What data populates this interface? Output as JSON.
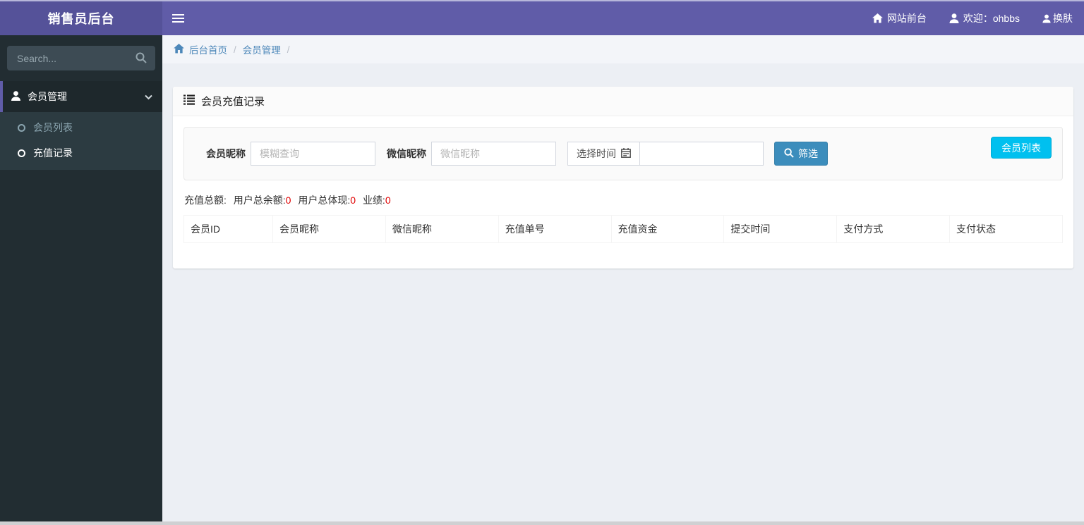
{
  "topbar": {
    "logo": "销售员后台",
    "site_front": "网站前台",
    "welcome": "欢迎：ohbbs",
    "skin": "换肤"
  },
  "sidebar": {
    "search_placeholder": "Search...",
    "menu": {
      "parent": {
        "label": "会员管理",
        "expanded": true
      },
      "children": [
        {
          "label": "会员列表",
          "active": false
        },
        {
          "label": "充值记录",
          "active": true
        }
      ]
    }
  },
  "breadcrumb": {
    "items": [
      "后台首页",
      "会员管理"
    ],
    "separator": "/"
  },
  "panel": {
    "title": "会员充值记录",
    "filter": {
      "member_label": "会员昵称",
      "member_placeholder": "模糊查询",
      "wechat_label": "微信昵称",
      "wechat_placeholder": "微信昵称",
      "time_label": "选择时间",
      "time_value": "",
      "filter_button": "筛选",
      "member_list_button": "会员列表"
    },
    "summary": {
      "recharge_total_label": "充值总额:",
      "user_balance_label": "用户总余额:",
      "user_balance_value": "0",
      "user_withdraw_label": "用户总体现:",
      "user_withdraw_value": "0",
      "performance_label": "业绩:",
      "performance_value": "0"
    },
    "table": {
      "headers": [
        "会员ID",
        "会员昵称",
        "微信昵称",
        "充值单号",
        "充值资金",
        "提交时间",
        "支付方式",
        "支付状态"
      ],
      "rows": []
    }
  },
  "colors": {
    "navbar": "#605ca8",
    "logo_bg": "#555299",
    "sidebar_bg": "#222d32",
    "submenu_bg": "#2c3b41",
    "active_border": "#605ca8",
    "content_bg": "#eceff4",
    "filter_button": "#3c8dbc",
    "member_list_button": "#00c0ef",
    "summary_value": "#e00000",
    "breadcrumb_link": "#4c87b9"
  }
}
